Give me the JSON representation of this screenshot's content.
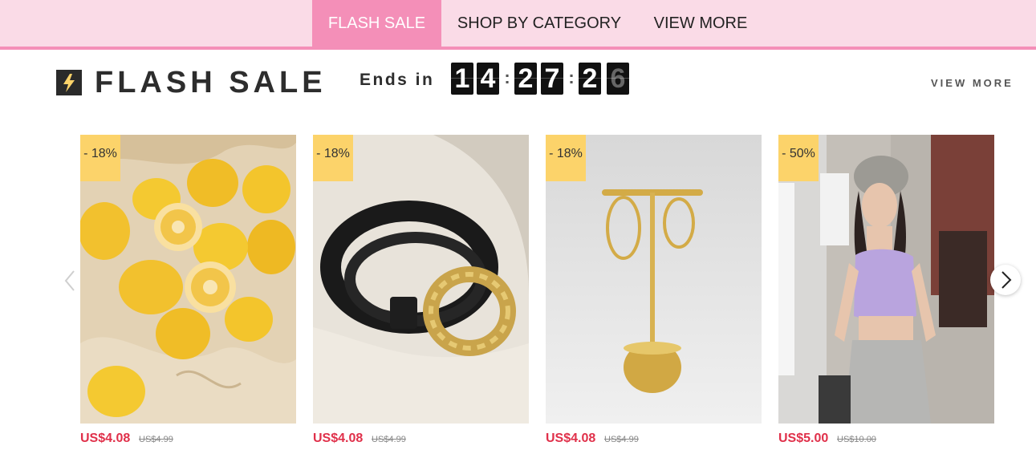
{
  "nav": {
    "tabs": [
      {
        "label": "FLASH SALE",
        "active": true
      },
      {
        "label": "SHOP BY CATEGORY",
        "active": false
      },
      {
        "label": "VIEW MORE",
        "active": false
      }
    ]
  },
  "flash_sale": {
    "icon": "lightning-icon",
    "title": "FLASH SALE",
    "ends_label": "Ends in",
    "countdown": {
      "hours": [
        "1",
        "4"
      ],
      "minutes": [
        "2",
        "7"
      ],
      "seconds": [
        "2",
        "6"
      ],
      "separator": ":"
    },
    "view_more": "VIEW MORE"
  },
  "products": [
    {
      "discount": "- 18%",
      "price": "US$4.08",
      "original_price": "US$4.99",
      "image": "lemons"
    },
    {
      "discount": "- 18%",
      "price": "US$4.08",
      "original_price": "US$4.99",
      "image": "black-belt-gold-buckle"
    },
    {
      "discount": "- 18%",
      "price": "US$4.08",
      "original_price": "US$4.99",
      "image": "gold-hoop-earrings-stand"
    },
    {
      "discount": "- 50%",
      "price": "US$5.00",
      "original_price": "US$10.00",
      "image": "woman-lilac-crop-top"
    }
  ],
  "carousel": {
    "prev_icon": "chevron-left-icon",
    "next_icon": "chevron-right-icon"
  },
  "colors": {
    "nav_bg": "#fadbe7",
    "accent_pink": "#f48fb8",
    "badge_yellow": "#fcd36a",
    "price_red": "#e0304a"
  }
}
